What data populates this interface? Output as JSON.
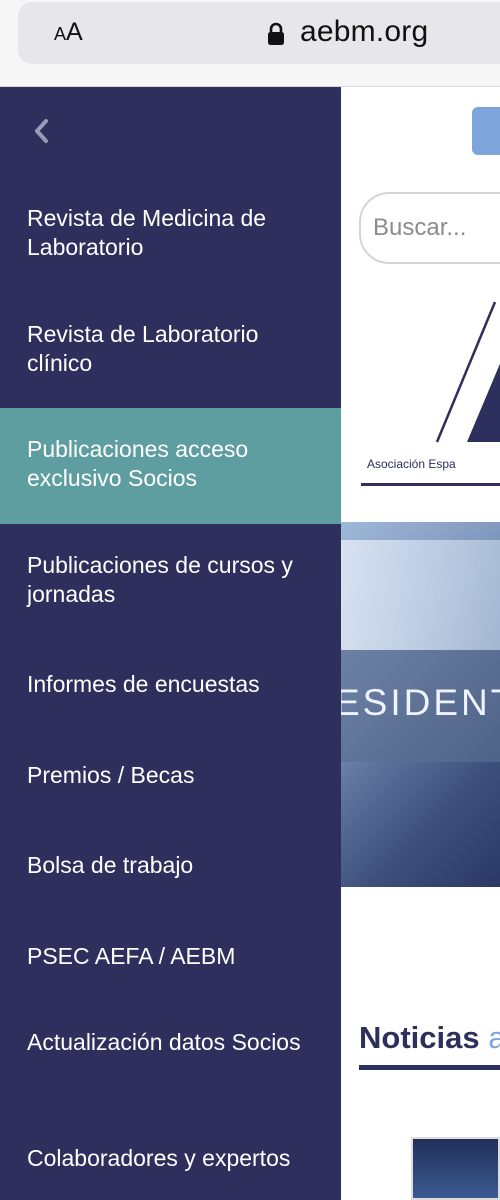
{
  "browser": {
    "text_size_label_small": "A",
    "text_size_label_big": "A",
    "url": "aebm.org"
  },
  "page": {
    "search_placeholder": "Buscar...",
    "logo_subtitle": "Asociación Espa",
    "banner_text": "ESIDENT",
    "news_heading": "Noticias",
    "news_heading_accent": "a"
  },
  "menu": {
    "items": [
      {
        "label": "Revista de Medicina de Laboratorio"
      },
      {
        "label": "Revista de Laboratorio clínico"
      },
      {
        "label": "Publicaciones acceso exclusivo Socios",
        "active": true
      },
      {
        "label": "Publicaciones de cursos y jornadas"
      },
      {
        "label": "Informes de encuestas"
      },
      {
        "label": "Premios / Becas"
      },
      {
        "label": "Bolsa de trabajo"
      },
      {
        "label": "PSEC AEFA / AEBM"
      },
      {
        "label": "Actualización datos Socios"
      },
      {
        "label": "Colaboradores y expertos"
      }
    ]
  },
  "colors": {
    "menu_bg": "#2f2f5d",
    "active_item_bg": "#5f9ea0",
    "brand_navy": "#2d2f5c",
    "accent_blue": "#7ea4dc"
  }
}
